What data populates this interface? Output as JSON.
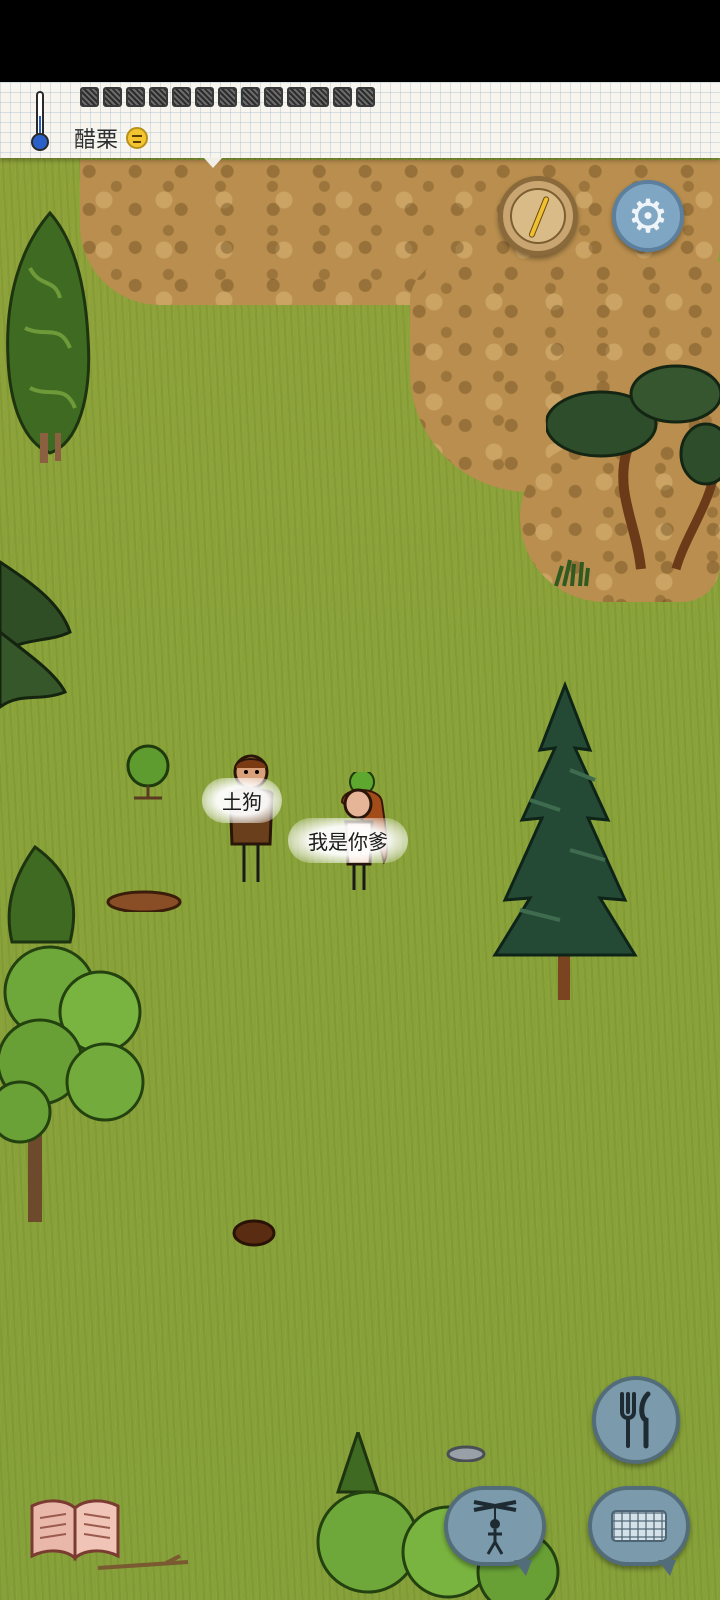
{
  "hud": {
    "player_name": "醋栗",
    "food_slots": 13,
    "mood": "neutral-face-icon"
  },
  "speech": {
    "bubble_1": "土狗",
    "bubble_2": "我是你爹"
  },
  "controls": {
    "compass": "compass-icon",
    "settings": "gear-icon",
    "eat": "fork-knife-icon",
    "emote": "puppet-icon",
    "chat": "keyboard-icon",
    "journal": "book-icon"
  },
  "colors": {
    "grass": "#8aa23a",
    "dirt": "#b98e4e",
    "hud_paper": "#f7f5ee",
    "button_blue": "#7b9aab"
  }
}
